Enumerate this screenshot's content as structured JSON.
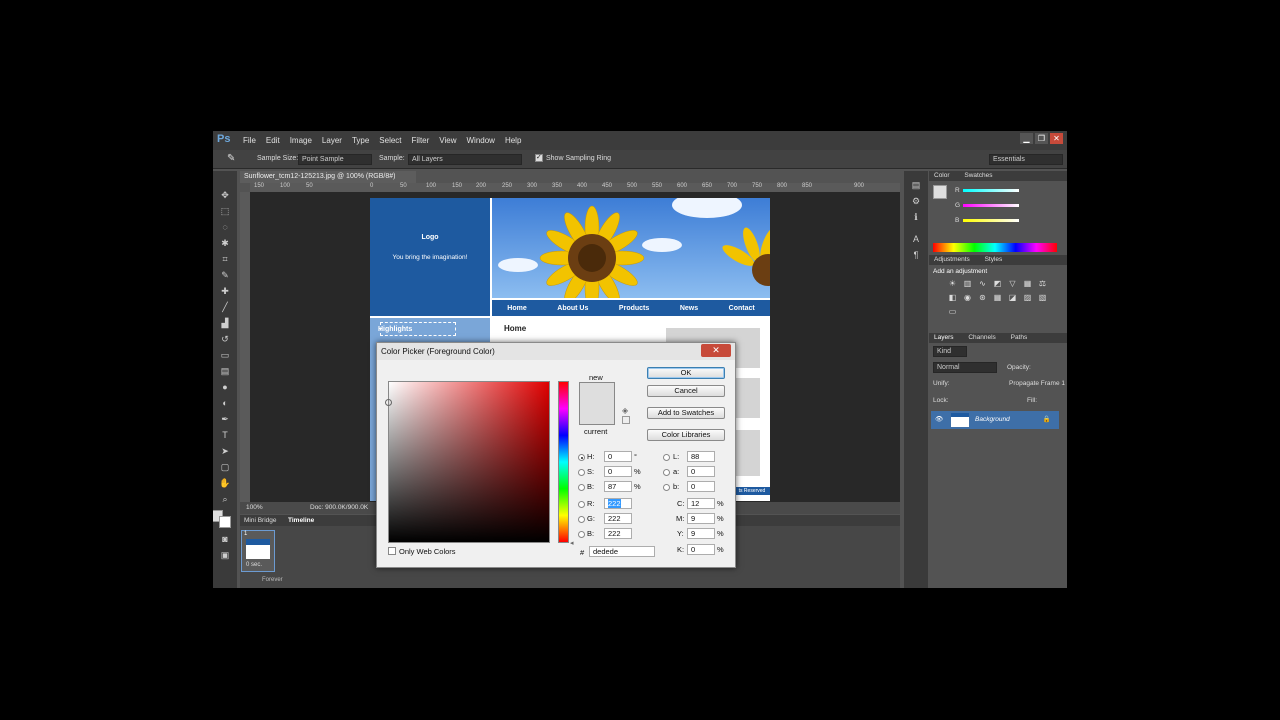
{
  "app": {
    "logo": "Ps",
    "win_min": "▁",
    "win_max": "❐",
    "win_close": "✕"
  },
  "menu": [
    "File",
    "Edit",
    "Image",
    "Layer",
    "Type",
    "Select",
    "Filter",
    "View",
    "Window",
    "Help"
  ],
  "options": {
    "sample_size_label": "Sample Size:",
    "sample_size_value": "Point Sample",
    "sample_label": "Sample:",
    "sample_value": "All Layers",
    "show_ring": "Show Sampling Ring",
    "workspace": "Essentials"
  },
  "document": {
    "tab": "Sunflower_tcm12-125213.jpg @ 100% (RGB/8#)",
    "ruler": [
      "150",
      "100",
      "50",
      "0",
      "50",
      "100",
      "150",
      "200",
      "250",
      "300",
      "350",
      "400",
      "450",
      "500",
      "550",
      "600",
      "650",
      "700",
      "750",
      "800",
      "850",
      "900"
    ],
    "logo": "Logo",
    "tagline": "You bring the imagination!",
    "nav": [
      "Home",
      "About Us",
      "Products",
      "News",
      "Contact"
    ],
    "side_label": "Highlights",
    "main_title": "Home",
    "footer": "ts Reserved"
  },
  "status": {
    "zoom": "100%",
    "doc": "Doc: 900.0K/900.0K"
  },
  "timeline": {
    "tab1": "Mini Bridge",
    "tab2": "Timeline",
    "frame_num": "1",
    "frame_time": "0 sec.",
    "forever": "Forever"
  },
  "panels": {
    "color_tab": "Color",
    "swatches_tab": "Swatches",
    "r": "R",
    "g": "G",
    "b": "B",
    "adjustments_tab": "Adjustments",
    "styles_tab": "Styles",
    "add_adjustment": "Add an adjustment",
    "layers_tab": "Layers",
    "channels_tab": "Channels",
    "paths_tab": "Paths",
    "kind": "Kind",
    "blend": "Normal",
    "opacity": "Opacity:",
    "unify": "Unify:",
    "propagate": "Propagate Frame 1",
    "lock": "Lock:",
    "fill": "Fill:",
    "layer_name": "Background"
  },
  "dialog": {
    "title": "Color Picker (Foreground Color)",
    "new_label": "new",
    "current_label": "current",
    "ok": "OK",
    "cancel": "Cancel",
    "add_to_swatches": "Add to Swatches",
    "color_libraries": "Color Libraries",
    "only_web_colors": "Only Web Colors",
    "H": {
      "label": "H:",
      "value": "0",
      "unit": "°"
    },
    "S": {
      "label": "S:",
      "value": "0",
      "unit": "%"
    },
    "Bv": {
      "label": "B:",
      "value": "87",
      "unit": "%"
    },
    "R": {
      "label": "R:",
      "value": "222"
    },
    "G": {
      "label": "G:",
      "value": "222"
    },
    "B": {
      "label": "B:",
      "value": "222"
    },
    "L": {
      "label": "L:",
      "value": "88"
    },
    "a": {
      "label": "a:",
      "value": "0"
    },
    "b": {
      "label": "b:",
      "value": "0"
    },
    "C": {
      "label": "C:",
      "value": "12",
      "unit": "%"
    },
    "M": {
      "label": "M:",
      "value": "9",
      "unit": "%"
    },
    "Y": {
      "label": "Y:",
      "value": "9",
      "unit": "%"
    },
    "K": {
      "label": "K:",
      "value": "0",
      "unit": "%"
    },
    "hash": "#",
    "hex": "dedede",
    "color": "#dedede"
  }
}
